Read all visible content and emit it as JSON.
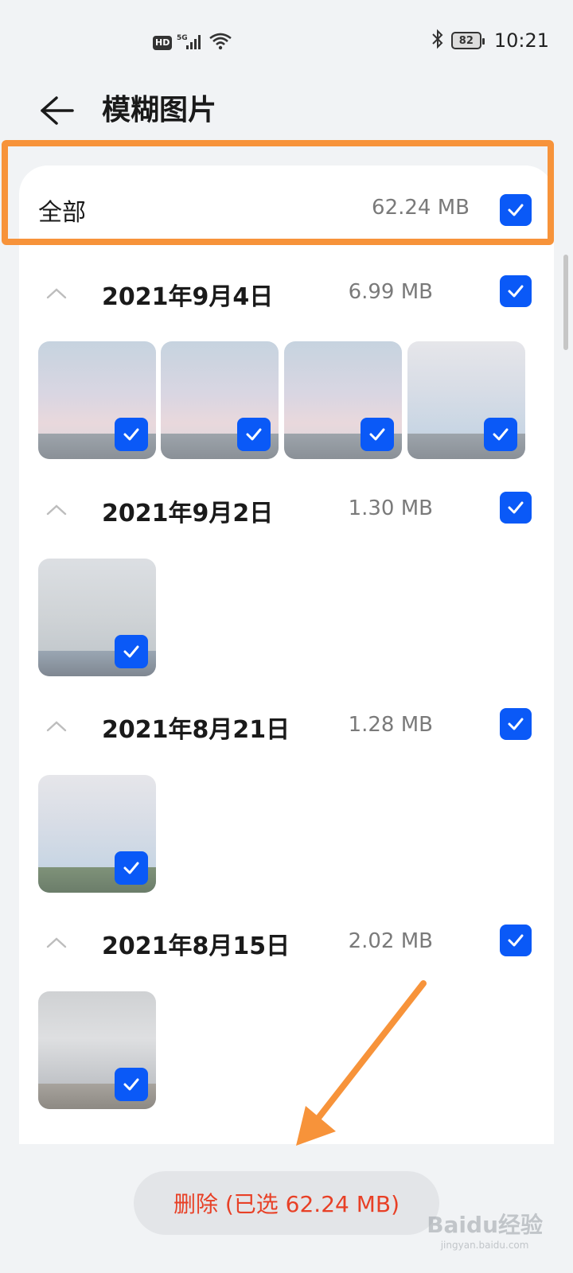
{
  "status_bar": {
    "hd_label": "HD",
    "network": "5G",
    "battery": "82",
    "time": "10:21"
  },
  "header": {
    "title": "模糊图片"
  },
  "all_row": {
    "label": "全部",
    "size": "62.24 MB",
    "checked": true
  },
  "groups": [
    {
      "date": "2021年9月4日",
      "size": "6.99 MB",
      "checked": true,
      "photo_count": 4
    },
    {
      "date": "2021年9月2日",
      "size": "1.30 MB",
      "checked": true,
      "photo_count": 1
    },
    {
      "date": "2021年8月21日",
      "size": "1.28 MB",
      "checked": true,
      "photo_count": 1
    },
    {
      "date": "2021年8月15日",
      "size": "2.02 MB",
      "checked": true,
      "photo_count": 1
    }
  ],
  "footer": {
    "delete_label": "删除 (已选 62.24 MB)"
  },
  "watermark": {
    "main": "Baidu经验",
    "sub": "jingyan.baidu.com"
  },
  "colors": {
    "accent": "#0a59f7",
    "delete_text": "#e84026",
    "annotation": "#f7933a",
    "background": "#f1f3f5"
  }
}
